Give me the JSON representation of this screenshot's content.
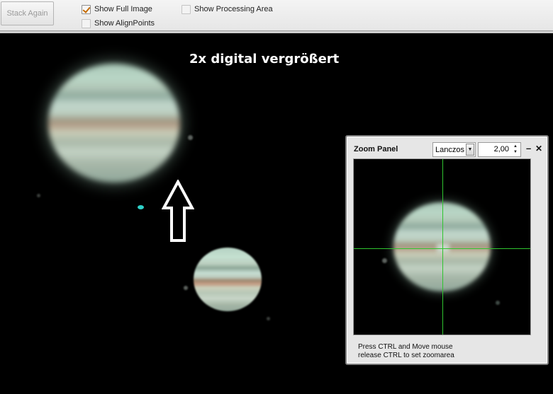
{
  "toolbar": {
    "stack_again_label": "Stack Again",
    "show_full_image_label": "Show Full Image",
    "show_full_image_checked": true,
    "show_processing_area_label": "Show Processing Area",
    "show_processing_area_checked": false,
    "show_alignpoints_label": "Show AlignPoints",
    "show_alignpoints_checked": false
  },
  "canvas": {
    "caption": "2x digital vergrößert"
  },
  "zoom_panel": {
    "title": "Zoom Panel",
    "filter_value": "Lanczos",
    "zoom_value": "2,00",
    "minimize_glyph": "–",
    "close_glyph": "✕",
    "hint_line1": "Press CTRL and Move mouse",
    "hint_line2": "release CTRL to set zoomarea",
    "crosshair_color": "#2fc42f"
  },
  "icons": {
    "arrow": "up-arrow-icon",
    "checkbox_check": "check-icon",
    "dropdown": "chevron-down-icon",
    "spinner": "spin-updown-icon"
  }
}
